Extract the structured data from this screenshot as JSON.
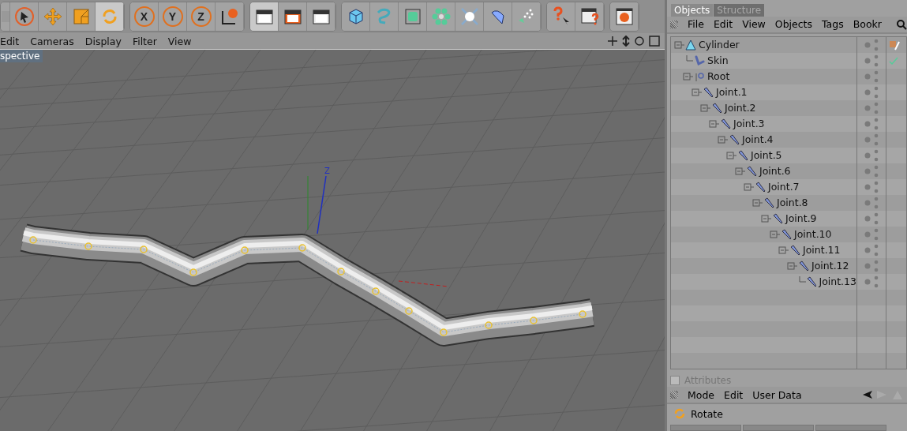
{
  "toolbar": {
    "groups": [
      {
        "buttons": [
          {
            "kind": "partial",
            "active": false
          },
          {
            "kind": "select",
            "active": false
          },
          {
            "kind": "move",
            "active": false
          },
          {
            "kind": "scale",
            "active": false
          },
          {
            "kind": "rotate",
            "active": true
          }
        ]
      },
      {
        "buttons": [
          {
            "kind": "axis",
            "label": "X",
            "active": false
          },
          {
            "kind": "axis",
            "label": "Y",
            "active": false
          },
          {
            "kind": "axis",
            "label": "Z",
            "active": false
          },
          {
            "kind": "world",
            "active": false
          }
        ]
      },
      {
        "buttons": [
          {
            "kind": "clapper",
            "active": true
          },
          {
            "kind": "clapper-red",
            "active": false
          },
          {
            "kind": "clapper-stack",
            "active": false
          }
        ]
      },
      {
        "buttons": [
          {
            "kind": "cube",
            "active": false
          },
          {
            "kind": "spline",
            "active": false
          },
          {
            "kind": "nurbs",
            "active": false
          },
          {
            "kind": "array",
            "active": false
          },
          {
            "kind": "deformer",
            "active": false
          },
          {
            "kind": "shape",
            "active": false
          },
          {
            "kind": "particles",
            "active": false
          }
        ]
      },
      {
        "buttons": [
          {
            "kind": "help",
            "active": false
          },
          {
            "kind": "help-table",
            "active": false
          }
        ]
      },
      {
        "buttons": [
          {
            "kind": "browser",
            "active": false
          }
        ]
      }
    ]
  },
  "viewport": {
    "menu": [
      "Edit",
      "Cameras",
      "Display",
      "Filter",
      "View"
    ],
    "label": "spective",
    "gizmo_label": "Z"
  },
  "objects_panel": {
    "tabs": [
      {
        "label": "Objects",
        "selected": true
      },
      {
        "label": "Structure",
        "selected": false
      }
    ],
    "menu": [
      "File",
      "Edit",
      "View",
      "Objects",
      "Tags",
      "Bookr"
    ],
    "tree": [
      {
        "name": "Cylinder",
        "kind": "cylinder",
        "expanded": true,
        "tags": [
          {
            "kind": "texture"
          }
        ],
        "children": [
          {
            "name": "Skin",
            "kind": "skin",
            "tags": [
              {
                "kind": "check"
              }
            ]
          },
          {
            "name": "Root",
            "kind": "null",
            "expanded": true,
            "children": [
              {
                "name": "Joint.1",
                "kind": "joint",
                "expanded": true,
                "children": [
                  {
                    "name": "Joint.2",
                    "kind": "joint",
                    "expanded": true,
                    "children": [
                      {
                        "name": "Joint.3",
                        "kind": "joint",
                        "expanded": true,
                        "children": [
                          {
                            "name": "Joint.4",
                            "kind": "joint",
                            "expanded": true,
                            "children": [
                              {
                                "name": "Joint.5",
                                "kind": "joint",
                                "expanded": true,
                                "children": [
                                  {
                                    "name": "Joint.6",
                                    "kind": "joint",
                                    "expanded": true,
                                    "children": [
                                      {
                                        "name": "Joint.7",
                                        "kind": "joint",
                                        "expanded": true,
                                        "children": [
                                          {
                                            "name": "Joint.8",
                                            "kind": "joint",
                                            "expanded": true,
                                            "children": [
                                              {
                                                "name": "Joint.9",
                                                "kind": "joint",
                                                "expanded": true,
                                                "children": [
                                                  {
                                                    "name": "Joint.10",
                                                    "kind": "joint",
                                                    "expanded": true,
                                                    "children": [
                                                      {
                                                        "name": "Joint.11",
                                                        "kind": "joint",
                                                        "expanded": true,
                                                        "children": [
                                                          {
                                                            "name": "Joint.12",
                                                            "kind": "joint",
                                                            "expanded": true,
                                                            "children": [
                                                              {
                                                                "name": "Joint.13",
                                                                "kind": "joint"
                                                              }
                                                            ]
                                                          }
                                                        ]
                                                      }
                                                    ]
                                                  }
                                                ]
                                              }
                                            ]
                                          }
                                        ]
                                      }
                                    ]
                                  }
                                ]
                              }
                            ]
                          }
                        ]
                      }
                    ]
                  }
                ]
              }
            ]
          }
        ]
      }
    ]
  },
  "attributes_panel": {
    "title": "Attributes",
    "checked": false,
    "menu": [
      "Mode",
      "Edit",
      "User Data"
    ],
    "object": "Rotate"
  }
}
